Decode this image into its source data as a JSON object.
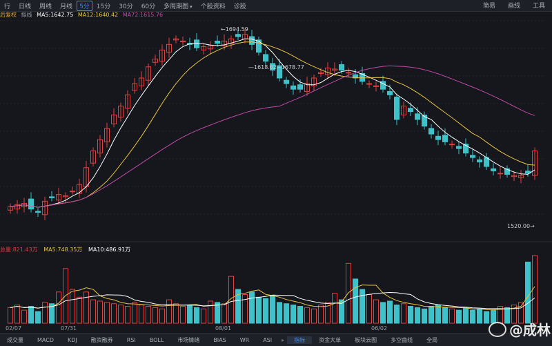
{
  "toolbar": {
    "items": [
      "行",
      "日线",
      "周线",
      "月线",
      "5分",
      "15分",
      "30分",
      "60分",
      "多周期图",
      "个股资料",
      "诊股"
    ],
    "active_index": 4,
    "dropdown_label": "多周期图",
    "right": [
      "简易",
      "画线",
      "工具"
    ]
  },
  "price_legend": {
    "label": "拟线",
    "ma5": "MA5:1642.75",
    "ma12": "MA12:1640.42",
    "ma72": "MA72:1615.76",
    "prefix": "后复权"
  },
  "annotations": {
    "high": "1694.59",
    "mid": "1618.62~1678.77",
    "low": "1520.00"
  },
  "volume_legend": {
    "vol": "总量:821.43万",
    "ma5": "MA5:748.35万",
    "ma10": "MA10:486.91万"
  },
  "dates": [
    "02/07",
    "07/31",
    "08/01",
    "06/02"
  ],
  "bottom_tabs": [
    "成交量",
    "MACD",
    "KDJ",
    "融资融券",
    "RSI",
    "BOLL",
    "市场情绪",
    "BIAS",
    "WR",
    "ASI",
    "指标",
    "资金大单",
    "板块云图",
    "多空曲线",
    "全局",
    "多空",
    "筹码"
  ],
  "bottom_active": 10,
  "watermark": "@成林",
  "colors": {
    "up": "#e04040",
    "down": "#3fc1c9",
    "ma5": "#ffffff",
    "ma12": "#e8c443",
    "ma72": "#c04aa8",
    "accent": "#3f8cff"
  },
  "chart_data": {
    "type": "candlestick",
    "series_close": [
      1540,
      1542,
      1543,
      1538,
      1535,
      1545,
      1548,
      1551,
      1550,
      1554,
      1560,
      1575,
      1590,
      1600,
      1610,
      1622,
      1630,
      1640,
      1650,
      1655,
      1665,
      1672,
      1680,
      1685,
      1690,
      1688,
      1685,
      1682,
      1683,
      1684,
      1686,
      1688,
      1690,
      1692,
      1694,
      1685,
      1678,
      1670,
      1662,
      1655,
      1650,
      1645,
      1645,
      1650,
      1655,
      1660,
      1664,
      1663,
      1662,
      1660,
      1655,
      1652,
      1650,
      1648,
      1645,
      1640,
      1618,
      1630,
      1625,
      1618,
      1612,
      1605,
      1600,
      1598,
      1596,
      1592,
      1588,
      1584,
      1580,
      1576,
      1572,
      1570,
      1569,
      1568,
      1568,
      1570,
      1590
    ],
    "volume": [
      120,
      140,
      100,
      130,
      90,
      160,
      150,
      240,
      420,
      260,
      200,
      240,
      180,
      170,
      160,
      150,
      140,
      130,
      160,
      140,
      130,
      120,
      110,
      180,
      150,
      130,
      140,
      120,
      110,
      170,
      160,
      150,
      360,
      260,
      220,
      240,
      200,
      190,
      210,
      160,
      150,
      140,
      130,
      120,
      110,
      140,
      160,
      230,
      180,
      460,
      340,
      260,
      220,
      180,
      160,
      170,
      140,
      150,
      130,
      120,
      110,
      130,
      140,
      120,
      110,
      100,
      120,
      100,
      110,
      90,
      100,
      130,
      120,
      140,
      160,
      470,
      520
    ]
  }
}
